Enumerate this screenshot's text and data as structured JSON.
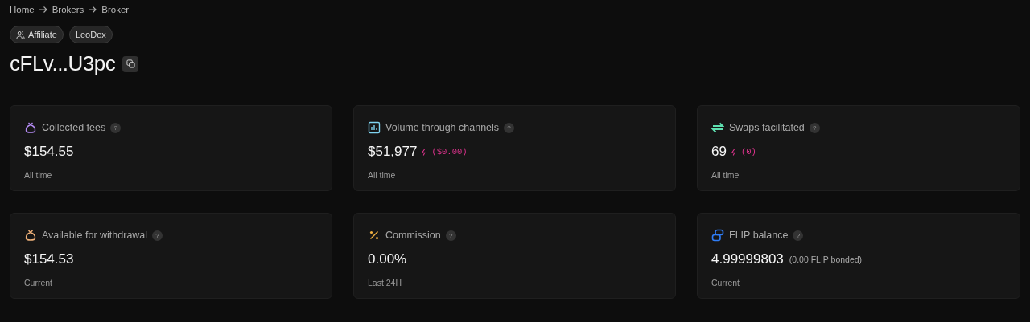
{
  "breadcrumb": [
    {
      "label": "Home"
    },
    {
      "label": "Brokers"
    },
    {
      "label": "Broker"
    }
  ],
  "tags": [
    {
      "label": "Affiliate",
      "kind": "role"
    },
    {
      "label": "LeoDex",
      "kind": "name"
    }
  ],
  "title": "cFLv...U3pc",
  "cards": [
    {
      "kind": "bag",
      "color": "#b58cf5",
      "label": "Collected fees",
      "help": "?",
      "value": "$154.55",
      "caption": "All time"
    },
    {
      "kind": "chart",
      "color": "#7fd3f0",
      "label": "Volume through channels",
      "help": "?",
      "value": "$51,977",
      "extra": {
        "kind": "boost",
        "text": "($0.00)"
      },
      "caption": "All time"
    },
    {
      "kind": "swap",
      "color": "#5ee0b0",
      "label": "Swaps facilitated",
      "help": "?",
      "value": "69",
      "extra": {
        "kind": "boost",
        "text": "(0)"
      },
      "caption": "All time"
    },
    {
      "kind": "bag",
      "color": "#f0b27a",
      "label": "Available for withdrawal",
      "help": "?",
      "value": "$154.53",
      "caption": "Current"
    },
    {
      "kind": "percent",
      "color": "#f0b040",
      "label": "Commission",
      "help": "?",
      "value": "0.00%",
      "caption": "Last 24H"
    },
    {
      "kind": "coins",
      "color": "#2f7df6",
      "label": "FLIP balance",
      "help": "?",
      "value": "4.99999803",
      "extra": {
        "kind": "note",
        "text": "(0.00 FLIP bonded)"
      },
      "caption": "Current"
    }
  ]
}
